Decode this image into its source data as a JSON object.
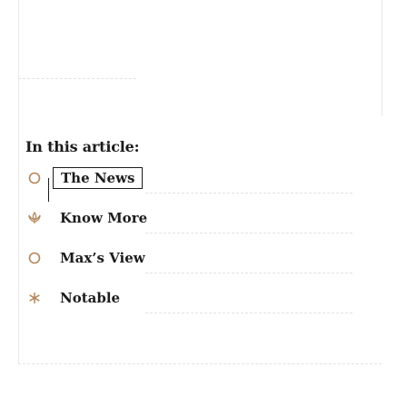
{
  "toc": {
    "title": "In this article:",
    "items": [
      {
        "label": "The News",
        "icon": "circle-icon",
        "active": true
      },
      {
        "label": "Know More",
        "icon": "lotus-icon",
        "active": false
      },
      {
        "label": "Max’s View",
        "icon": "circle-icon",
        "active": false
      },
      {
        "label": "Notable",
        "icon": "asterisk-icon",
        "active": false
      }
    ]
  },
  "colors": {
    "accent": "#b3865a",
    "text": "#1c1c1c",
    "rule": "#e2e2e2"
  }
}
